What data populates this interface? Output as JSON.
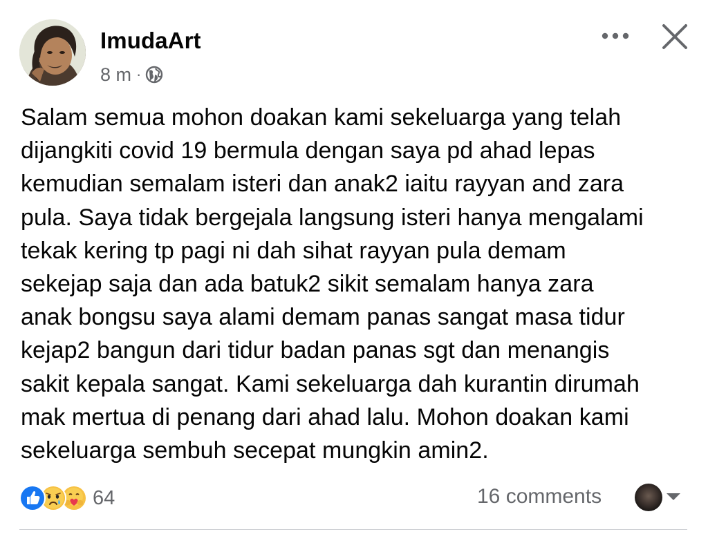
{
  "post": {
    "author": "ImudaArt",
    "time": "8 m",
    "meta_separator": "·",
    "privacy_icon": "globe-icon",
    "body_lines": [
      "Salam semua mohon doakan kami sekeluarga yang telah",
      "dijangkiti covid 19 bermula dengan saya pd ahad lepas",
      "kemudian semalam isteri dan anak2 iaitu rayyan and zara",
      "pula. Saya tidak bergejala langsung isteri hanya mengalami",
      "tekak kering tp pagi ni dah sihat rayyan pula demam",
      "sekejap saja dan ada batuk2 sikit semalam hanya zara",
      "anak bongsu saya alami demam panas sangat masa tidur",
      "kejap2 bangun dari tidur badan panas sgt dan menangis",
      "sakit kepala sangat. Kami sekeluarga dah kurantin dirumah",
      "mak mertua di penang dari ahad lalu. Mohon doakan kami",
      "sekeluarga sembuh secepat mungkin amin2."
    ]
  },
  "header_actions": {
    "more_icon": "more-horizontal-icon",
    "close_icon": "close-icon"
  },
  "footer": {
    "reactions": [
      "like",
      "sad",
      "care"
    ],
    "reaction_count": "64",
    "comments": "16 comments"
  },
  "colors": {
    "text": "#050505",
    "secondary_text": "#65676b",
    "like_blue": "#1877f2",
    "emoji_yellow": "#f7c143",
    "divider": "#ced0d4"
  }
}
